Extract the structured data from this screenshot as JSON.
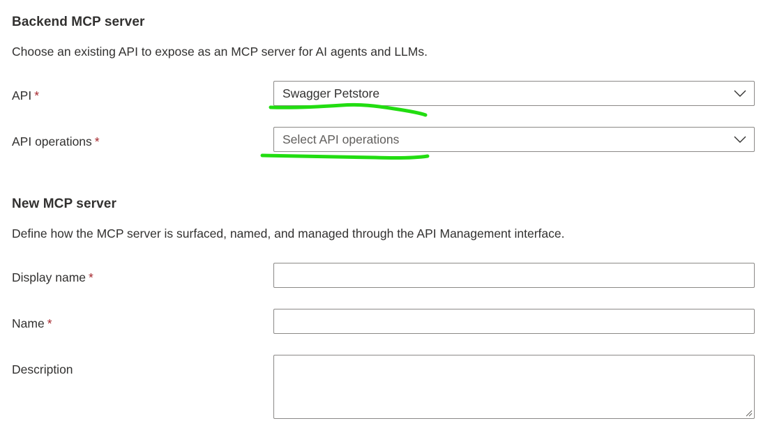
{
  "backend": {
    "title": "Backend MCP server",
    "description": "Choose an existing API to expose as an MCP server for AI agents and LLMs.",
    "api": {
      "label": "API",
      "required_mark": "*",
      "value": "Swagger Petstore"
    },
    "api_operations": {
      "label": "API operations",
      "required_mark": "*",
      "placeholder": "Select API operations"
    }
  },
  "new_server": {
    "title": "New MCP server",
    "description": "Define how the MCP server is surfaced, named, and managed through the API Management interface.",
    "display_name": {
      "label": "Display name",
      "required_mark": "*",
      "value": ""
    },
    "name": {
      "label": "Name",
      "required_mark": "*",
      "value": ""
    },
    "description_field": {
      "label": "Description",
      "value": ""
    }
  },
  "colors": {
    "required": "#a4262c",
    "annotation": "#22dd11",
    "border": "#8a8886",
    "text": "#323130"
  },
  "icons": {
    "dropdown": "chevron-down-icon",
    "resize": "resize-grip-icon"
  }
}
